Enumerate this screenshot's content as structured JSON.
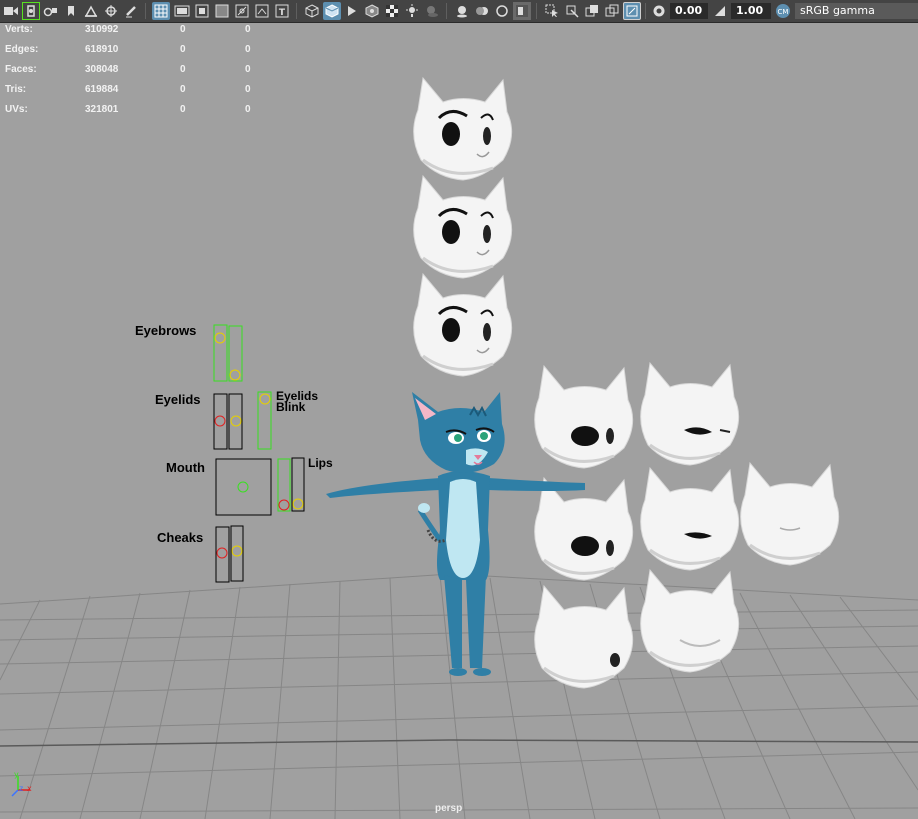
{
  "toolbar": {
    "icons": [
      "camera-icon",
      "select-camera-icon",
      "lock-camera-icon",
      "bookmark-icon",
      "image-plane-icon",
      "camera-attributes-icon",
      "grease-pencil-icon",
      "grid-icon",
      "film-gate-icon",
      "resolution-gate-icon",
      "gate-mask-icon",
      "field-chart-icon",
      "safe-action-icon",
      "safe-title-icon",
      "wireframe-icon",
      "smooth-shade-icon",
      "use-default-material-icon",
      "wireframe-on-shaded-icon",
      "textured-icon",
      "use-all-lights-icon",
      "shadows-icon",
      "screen-space-ao-icon",
      "motion-blur-icon",
      "multisample-aa-icon",
      "depth-of-field-icon",
      "isolate-select-icon",
      "xray-icon",
      "xray-active-components-icon",
      "xray-joints-icon",
      "exposure-icon",
      "gamma-icon",
      "view-transform-icon"
    ],
    "exposure_value": "0.00",
    "gamma_value": "1.00",
    "view_transform": "sRGB gamma"
  },
  "hud": {
    "rows": [
      {
        "label": "Verts:",
        "total": "310992",
        "sel": "0",
        "comp": "0"
      },
      {
        "label": "Edges:",
        "total": "618910",
        "sel": "0",
        "comp": "0"
      },
      {
        "label": "Faces:",
        "total": "308048",
        "sel": "0",
        "comp": "0"
      },
      {
        "label": "Tris:",
        "total": "619884",
        "sel": "0",
        "comp": "0"
      },
      {
        "label": "UVs:",
        "total": "321801",
        "sel": "0",
        "comp": "0"
      }
    ]
  },
  "controls": {
    "eyebrows": "Eyebrows",
    "eyelids": "Eyelids",
    "eyelids_blink_1": "Eyelids",
    "eyelids_blink_2": "Blink",
    "mouth": "Mouth",
    "lips": "Lips",
    "cheeks": "Cheaks"
  },
  "camera_label": "persp",
  "axis": {
    "x": "x",
    "y": "y",
    "z": "z"
  },
  "colors": {
    "viewport_bg": "#a0a0a0",
    "toolbar_bg": "#444444",
    "active_icon": "#5d8fb0",
    "character_blue": "#2f7fa6",
    "control_yellow": "#e6d000",
    "control_red": "#e02020",
    "control_green": "#39e021"
  }
}
